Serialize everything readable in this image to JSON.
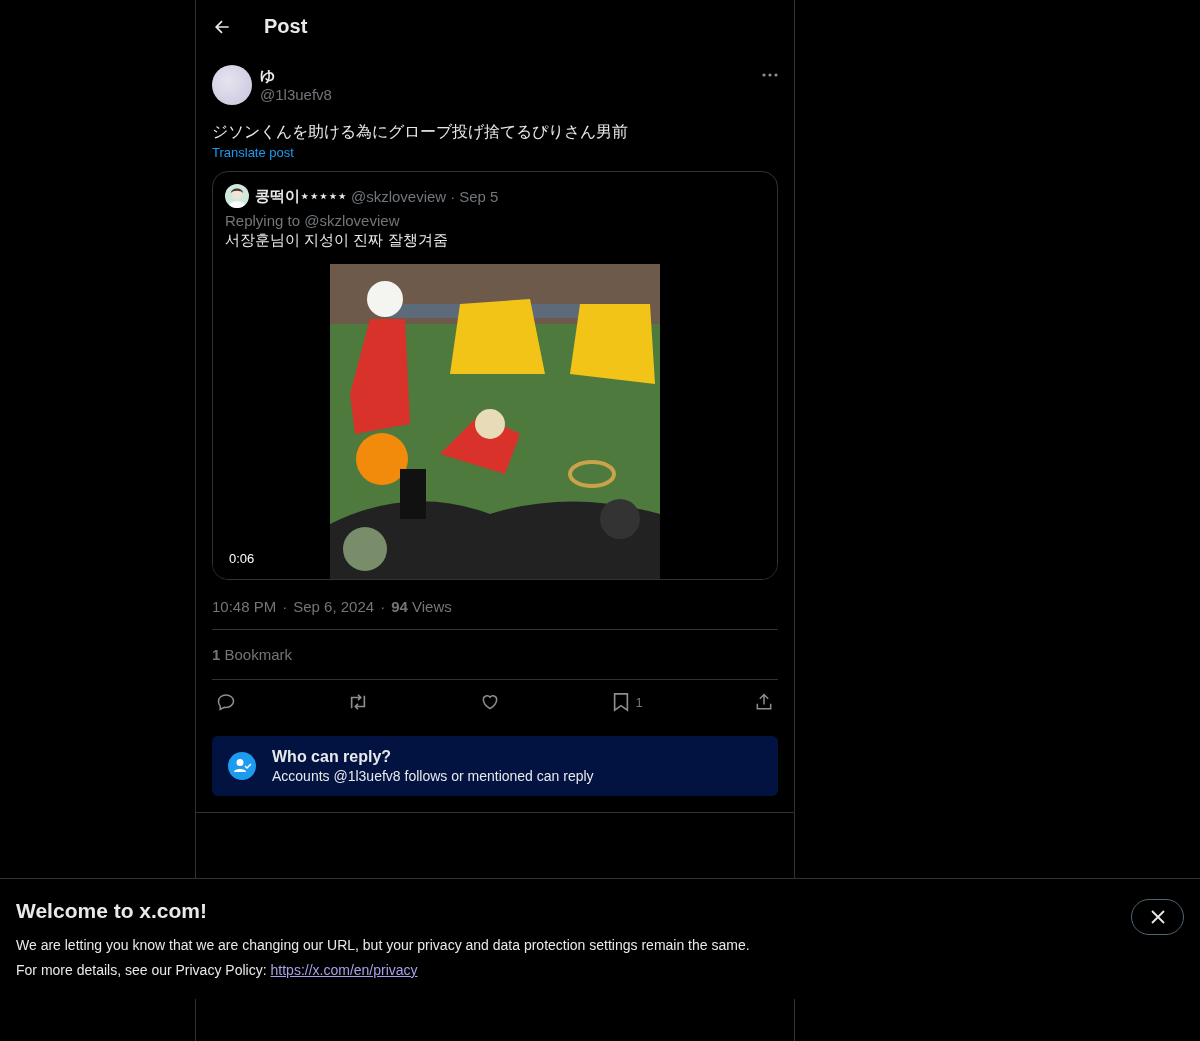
{
  "header": {
    "title": "Post"
  },
  "post": {
    "author": {
      "name": "ゆ",
      "handle": "@1l3uefv8"
    },
    "text": "ジソンくんを助ける為にグローブ投げ捨てるぴりさん男前",
    "translate": "Translate post",
    "quote": {
      "name": "콩떡이⋆⋆⋆⋆⋆",
      "handle": "@skzloveview",
      "dot": "·",
      "date": "Sep 5",
      "replying": "Replying to @skzloveview",
      "text": "서장훈님이 지성이 진짜 잘챙겨줌",
      "media": {
        "duration": "0:06"
      }
    },
    "meta": [
      {
        "kind": "time",
        "text": "10:48 PM"
      },
      {
        "kind": "dot",
        "text": "·"
      },
      {
        "kind": "date",
        "text": "Sep 6, 2024"
      },
      {
        "kind": "dot",
        "text": "·"
      },
      {
        "kind": "views",
        "text": "**94** Views"
      }
    ],
    "bookmarks": "**1** Bookmark",
    "actions": [
      {
        "kind": "reply"
      },
      {
        "kind": "repost"
      },
      {
        "kind": "like"
      },
      {
        "kind": "bookmark",
        "count": "1"
      },
      {
        "kind": "share"
      }
    ],
    "who_can_reply": {
      "title": "Who can reply?",
      "text": "Accounts @1l3uefv8 follows or mentioned can reply"
    }
  },
  "banner": {
    "title": "Welcome to x.com!",
    "line1": "We are letting you know that we are changing our URL, but your privacy and data protection settings remain the same.",
    "line2": "For more details, see our Privacy Policy:",
    "link": "https://x.com/en/privacy"
  }
}
